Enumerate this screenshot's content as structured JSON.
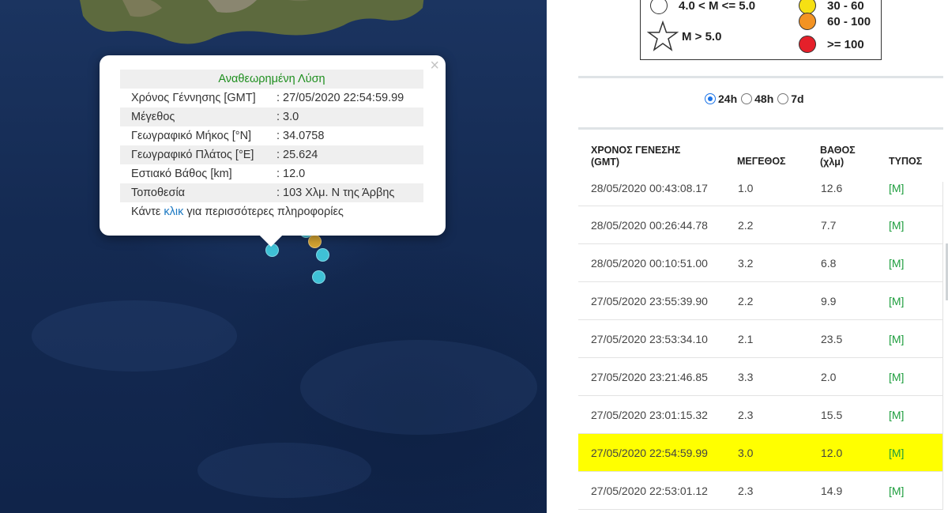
{
  "popup": {
    "heading": "Αναθεωρημένη Λύση",
    "close": "×",
    "rows": [
      {
        "label": "Χρόνος Γέννησης [GMT]",
        "value": ": 27/05/2020 22:54:59.99"
      },
      {
        "label": "Μέγεθος",
        "value": ": 3.0"
      },
      {
        "label": "Γεωγραφικό Μήκος [°N]",
        "value": ": 34.0758"
      },
      {
        "label": "Γεωγραφικό Πλάτος [°E]",
        "value": ": 25.624"
      },
      {
        "label": "Εστιακό Βάθος [km]",
        "value": ": 12.0"
      },
      {
        "label": "Τοποθεσία",
        "value": ": 103 Χλμ. Ν της Άρβης"
      }
    ],
    "more_prefix": "Κάντε ",
    "more_link": "κλικ",
    "more_suffix": " για περισσότερες πληροφορίες"
  },
  "legend": {
    "magnitude": [
      {
        "label": "4.0 < M <= 5.0",
        "symbol": "circle"
      },
      {
        "label": "M > 5.0",
        "symbol": "star"
      }
    ],
    "depth": [
      {
        "label": "30 - 60",
        "color": "#f5e013"
      },
      {
        "label": "60 - 100",
        "color": "#f39323"
      },
      {
        "label": ">= 100",
        "color": "#e5202a"
      }
    ]
  },
  "filters": {
    "options": [
      "24h",
      "48h",
      "7d"
    ],
    "selected": "24h"
  },
  "table": {
    "headers": {
      "time_line1": "ΧΡΟΝΟΣ ΓΕΝΕΣΗΣ",
      "time_line2": "(GMT)",
      "magnitude": "ΜΕΓΕΘΟΣ",
      "depth_line1": "ΒΑΘΟΣ",
      "depth_line2": "(χλμ)",
      "type": "ΤΥΠΟΣ"
    },
    "rows": [
      {
        "time": "28/05/2020 00:43:08.17",
        "mag": "1.0",
        "depth": "12.6",
        "type": "[M]"
      },
      {
        "time": "28/05/2020 00:26:44.78",
        "mag": "2.2",
        "depth": "7.7",
        "type": "[M]"
      },
      {
        "time": "28/05/2020 00:10:51.00",
        "mag": "3.2",
        "depth": "6.8",
        "type": "[M]"
      },
      {
        "time": "27/05/2020 23:55:39.90",
        "mag": "2.2",
        "depth": "9.9",
        "type": "[M]"
      },
      {
        "time": "27/05/2020 23:53:34.10",
        "mag": "2.1",
        "depth": "23.5",
        "type": "[M]"
      },
      {
        "time": "27/05/2020 23:21:46.85",
        "mag": "3.3",
        "depth": "2.0",
        "type": "[M]"
      },
      {
        "time": "27/05/2020 23:01:15.32",
        "mag": "2.3",
        "depth": "15.5",
        "type": "[M]"
      },
      {
        "time": "27/05/2020 22:54:59.99",
        "mag": "3.0",
        "depth": "12.0",
        "type": "[M]",
        "highlighted": true
      },
      {
        "time": "27/05/2020 22:53:01.12",
        "mag": "2.3",
        "depth": "14.9",
        "type": "[M]"
      }
    ]
  },
  "colors": {
    "highlight": "#ffff00",
    "type_text": "#1e9e3e",
    "popup_heading": "#1f8f1f",
    "marker_shallow": "#3fc1d6",
    "marker_mid": "#d6a532"
  }
}
